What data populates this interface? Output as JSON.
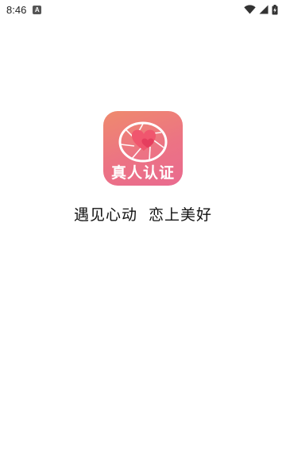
{
  "status_bar": {
    "time": "8:46",
    "notification_icon": "app-notification-icon",
    "notification_glyph": "A",
    "wifi_icon": "wifi-icon",
    "signal_icon": "cellular-signal-icon",
    "battery_icon": "battery-charging-icon"
  },
  "splash": {
    "app_icon_caption": "真人认证",
    "tagline": "遇见心动  恋上美好",
    "colors": {
      "icon_gradient_start": "#ef8a6d",
      "icon_gradient_end": "#e96a8f",
      "heart": "#f0566e",
      "background": "#ffffff"
    }
  }
}
